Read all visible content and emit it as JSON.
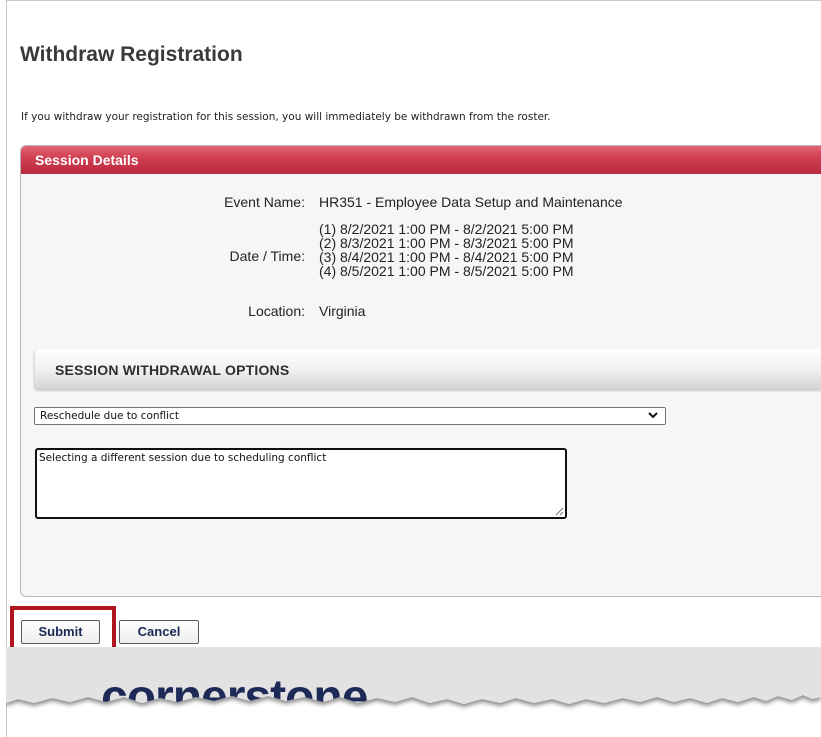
{
  "page": {
    "title": "Withdraw Registration",
    "intro": "If you withdraw your registration for this session, you will immediately be withdrawn from the roster."
  },
  "session_details": {
    "header": "Session Details",
    "event_name_label": "Event Name:",
    "event_name": "HR351 - Employee Data Setup and Maintenance",
    "date_time_label": "Date / Time:",
    "dates": [
      "(1) 8/2/2021 1:00 PM - 8/2/2021 5:00 PM",
      "(2) 8/3/2021 1:00 PM - 8/3/2021 5:00 PM",
      "(3) 8/4/2021 1:00 PM - 8/4/2021 5:00 PM",
      "(4) 8/5/2021 1:00 PM - 8/5/2021 5:00 PM"
    ],
    "location_label": "Location:",
    "location": "Virginia"
  },
  "withdrawal": {
    "section_title": "SESSION WITHDRAWAL OPTIONS",
    "reason_selected": "Reschedule due to conflict",
    "comment": "Selecting a different session due to scheduling conflict"
  },
  "actions": {
    "submit_label": "Submit",
    "cancel_label": "Cancel"
  },
  "footer": {
    "logo_text": "cornerstone"
  },
  "colors": {
    "header_red": "#cf3c4f",
    "highlight_red": "#b0141e",
    "footer_gray": "#e2e2e2",
    "logo_navy": "#1d2a57"
  }
}
